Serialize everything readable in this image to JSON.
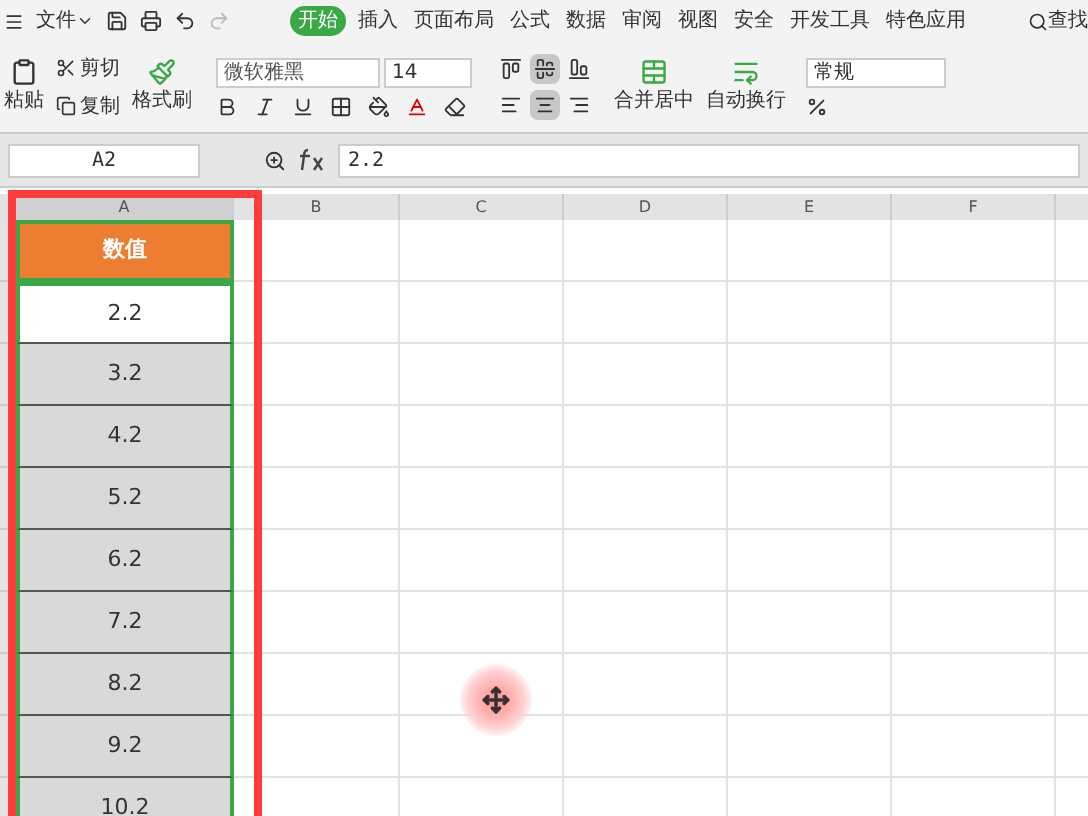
{
  "menu": {
    "file": "文件",
    "tabs": [
      {
        "label": "开始",
        "selected": true
      },
      {
        "label": "插入",
        "selected": false
      },
      {
        "label": "页面布局",
        "selected": false
      },
      {
        "label": "公式",
        "selected": false
      },
      {
        "label": "数据",
        "selected": false
      },
      {
        "label": "审阅",
        "selected": false
      },
      {
        "label": "视图",
        "selected": false
      },
      {
        "label": "安全",
        "selected": false
      },
      {
        "label": "开发工具",
        "selected": false
      },
      {
        "label": "特色应用",
        "selected": false
      }
    ],
    "search": "查找"
  },
  "ribbon": {
    "paste": "粘贴",
    "cut": "剪切",
    "copy": "复制",
    "format_painter": "格式刷",
    "font": "微软雅黑",
    "size": "14",
    "merge": "合并居中",
    "wrap": "自动换行",
    "number_format": "常规",
    "vertical_align": [
      {
        "selected": false
      },
      {
        "selected": true
      },
      {
        "selected": false
      }
    ],
    "horizontal_align": [
      {
        "selected": false
      },
      {
        "selected": true
      },
      {
        "selected": false
      }
    ]
  },
  "formula_bar": {
    "cell": "A2",
    "value": "2.2"
  },
  "columns": [
    "A",
    "B",
    "C",
    "D",
    "E",
    "F"
  ],
  "header_cell": "数值",
  "rows": [
    {
      "value": "2.2",
      "selected": true
    },
    {
      "value": "3.2",
      "selected": false
    },
    {
      "value": "4.2",
      "selected": false
    },
    {
      "value": "5.2",
      "selected": false
    },
    {
      "value": "6.2",
      "selected": false
    },
    {
      "value": "7.2",
      "selected": false
    },
    {
      "value": "8.2",
      "selected": false
    },
    {
      "value": "9.2",
      "selected": false
    },
    {
      "value": "10.2",
      "selected": false
    }
  ]
}
